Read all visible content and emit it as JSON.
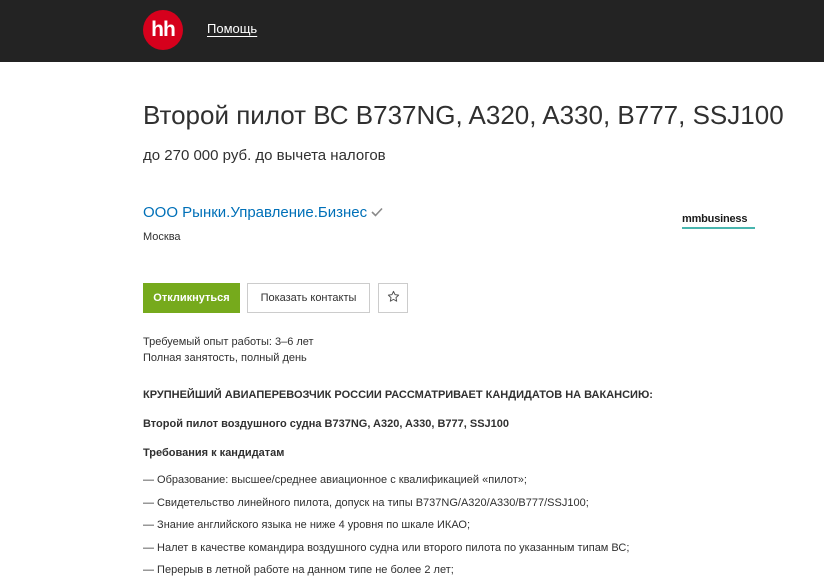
{
  "header": {
    "logo_text": "hh",
    "help_link": "Помощь"
  },
  "vacancy": {
    "title": "Второй пилот ВС B737NG, A320, A330, B777, SSJ100",
    "salary": "до 270 000 руб. до вычета налогов",
    "company": "ООО Рынки.Управление.Бизнес",
    "city": "Москва",
    "brand_logo": "mmbusiness"
  },
  "actions": {
    "respond_label": "Откликнуться",
    "contacts_label": "Показать контакты",
    "favorite_icon": "star-icon"
  },
  "meta": {
    "experience": "Требуемый опыт работы: 3–6 лет",
    "employment": "Полная занятость, полный день"
  },
  "description": {
    "headline": "КРУПНЕЙШИЙ АВИАПЕРЕВОЗЧИК РОССИИ РАССМАТРИВАЕТ КАНДИДАТОВ НА ВАКАНСИЮ:",
    "position": "Второй пилот воздушного судна B737NG, A320, A330, B777, SSJ100",
    "requirements_title": "Требования к кандидатам",
    "requirements": [
      "— Образование: высшее/среднее авиационное с квалификацией «пилот»;",
      "— Свидетельство линейного пилота, допуск на типы B737NG/A320/A330/B777/SSJ100;",
      "— Знание английского языка не ниже 4 уровня по шкале ИКАО;",
      "— Налет в качестве командира воздушного судна или второго пилота по указанным типам ВС;",
      "— Перерыв в летной работе на данном типе не более 2 лет;"
    ]
  },
  "colors": {
    "header_bg": "#232323",
    "logo_red": "#d6001c",
    "link_blue": "#0070b8",
    "respond_green": "#76aa1c"
  }
}
